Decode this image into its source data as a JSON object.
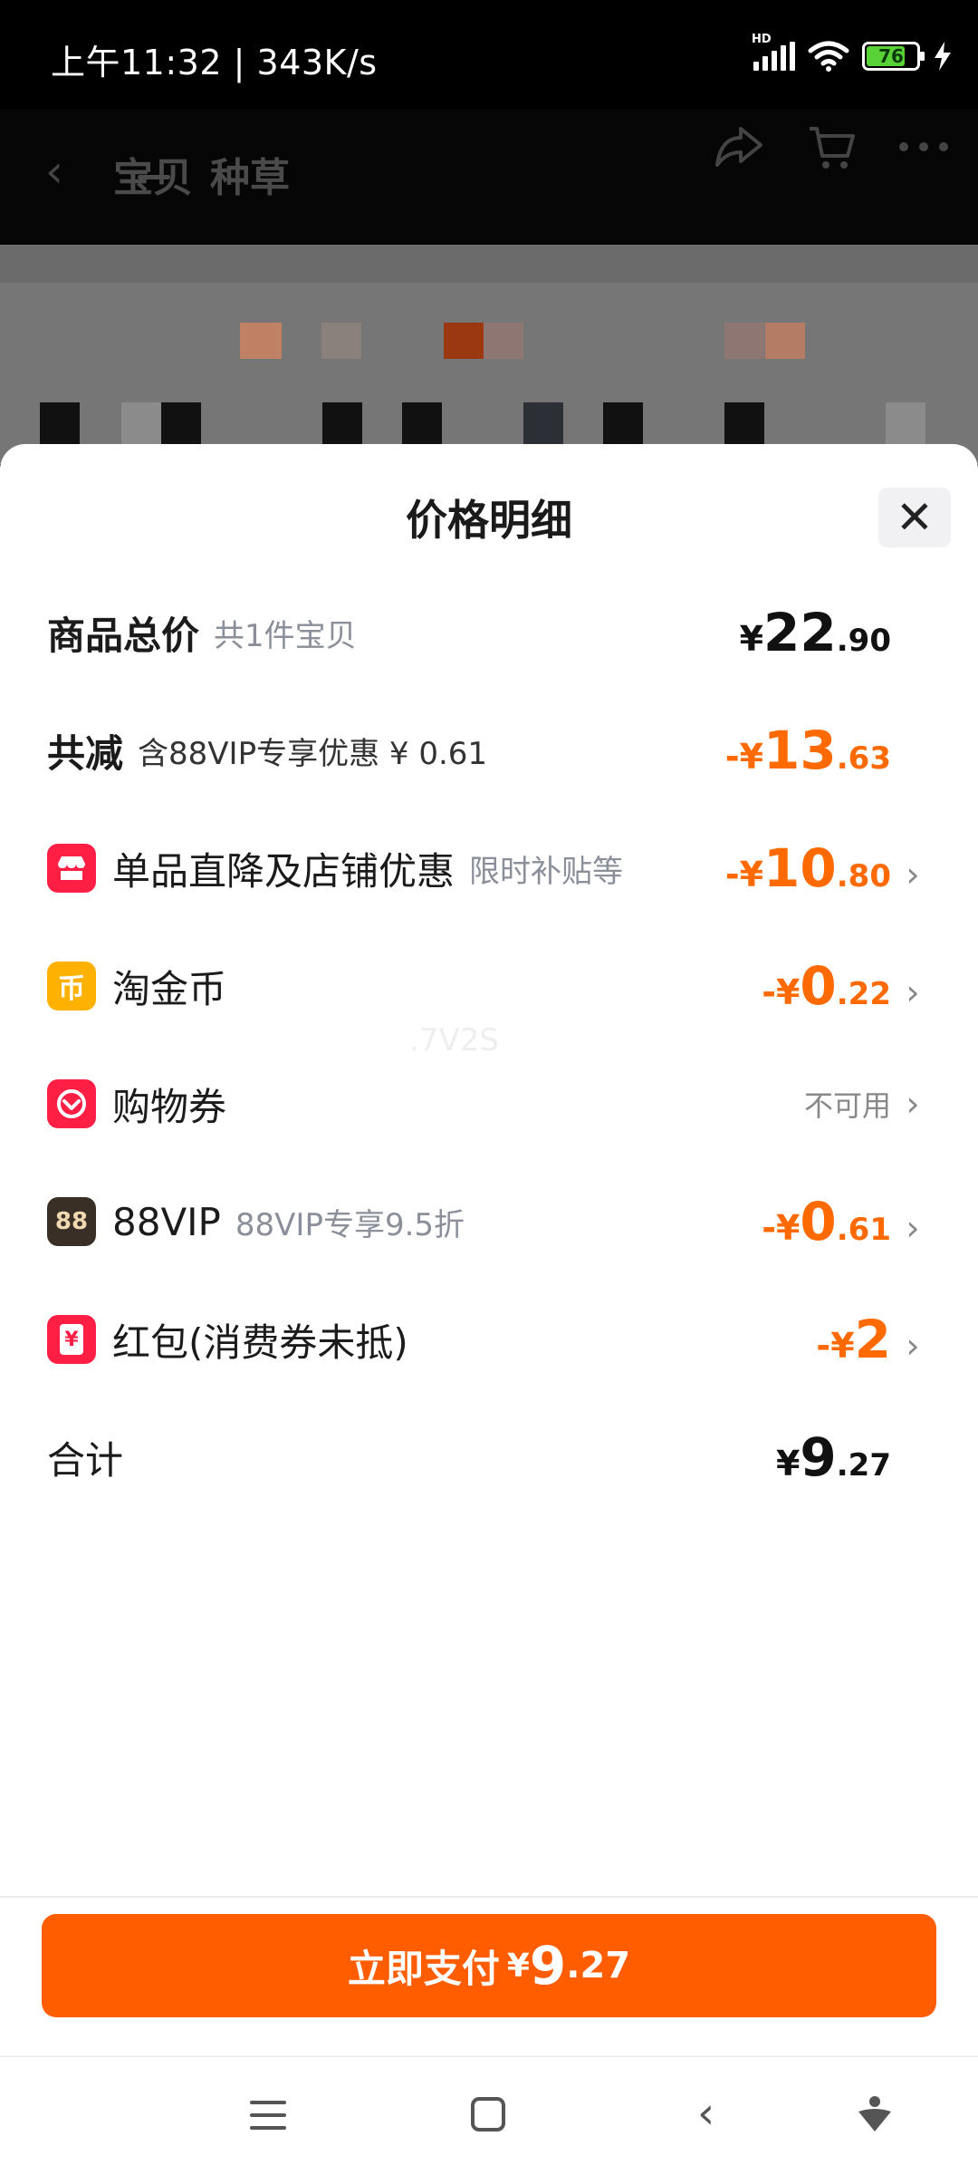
{
  "status_bar": {
    "time": "上午11:32",
    "separator": "|",
    "speed": "343K/s",
    "network_label": "HD",
    "battery": "76",
    "icons": [
      "signal-icon",
      "wifi-icon",
      "battery-icon",
      "charging-icon"
    ]
  },
  "background_page": {
    "tabs": [
      "宝贝",
      "种草"
    ],
    "icons": [
      "back-icon",
      "share-icon",
      "cart-icon",
      "more-icon"
    ]
  },
  "sheet": {
    "title": "价格明细",
    "close_icon": "close-icon",
    "rows": {
      "total_goods": {
        "label": "商品总价",
        "sub": "共1件宝贝",
        "symbol": "¥",
        "int": "22",
        "dec": ".90"
      },
      "discount": {
        "label": "共减",
        "sub": "含88VIP专享优惠 ¥ 0.61",
        "symbol": "-¥",
        "int": "13",
        "dec": ".63"
      },
      "shop_discount": {
        "icon": "shop-icon",
        "label": "单品直降及店铺优惠",
        "sub": "限时补贴等",
        "symbol": "-¥",
        "int": "10",
        "dec": ".80"
      },
      "coins": {
        "icon": "coin-icon",
        "label": "淘金币",
        "symbol": "-¥",
        "int": "0",
        "dec": ".22"
      },
      "coupon": {
        "icon": "coupon-icon",
        "label": "购物券",
        "value": "不可用"
      },
      "vip": {
        "icon": "vip-88-icon",
        "icon_text": "88",
        "label": "88VIP",
        "sub": "88VIP专享9.5折",
        "symbol": "-¥",
        "int": "0",
        "dec": ".61"
      },
      "red_packet": {
        "icon": "red-packet-icon",
        "icon_text": "¥",
        "label": "红包(消费券未抵)",
        "symbol": "-¥",
        "int": "2",
        "dec": ""
      },
      "total": {
        "label": "合计",
        "symbol": "¥",
        "int": "9",
        "dec": ".27"
      }
    },
    "watermark": ".7V2S",
    "pay_button": {
      "label": "立即支付",
      "symbol": "¥",
      "int": "9",
      "dec": ".27"
    }
  },
  "colors": {
    "accent": "#ff5d00",
    "discount_text": "#ff6a00",
    "icon_red": "#ff1e44",
    "icon_gold": "#ffb100",
    "icon_vip": "#3a2f26"
  },
  "nav_bar": {
    "icons": [
      "menu-icon",
      "home-icon",
      "back-nav-icon",
      "assistant-icon"
    ]
  }
}
